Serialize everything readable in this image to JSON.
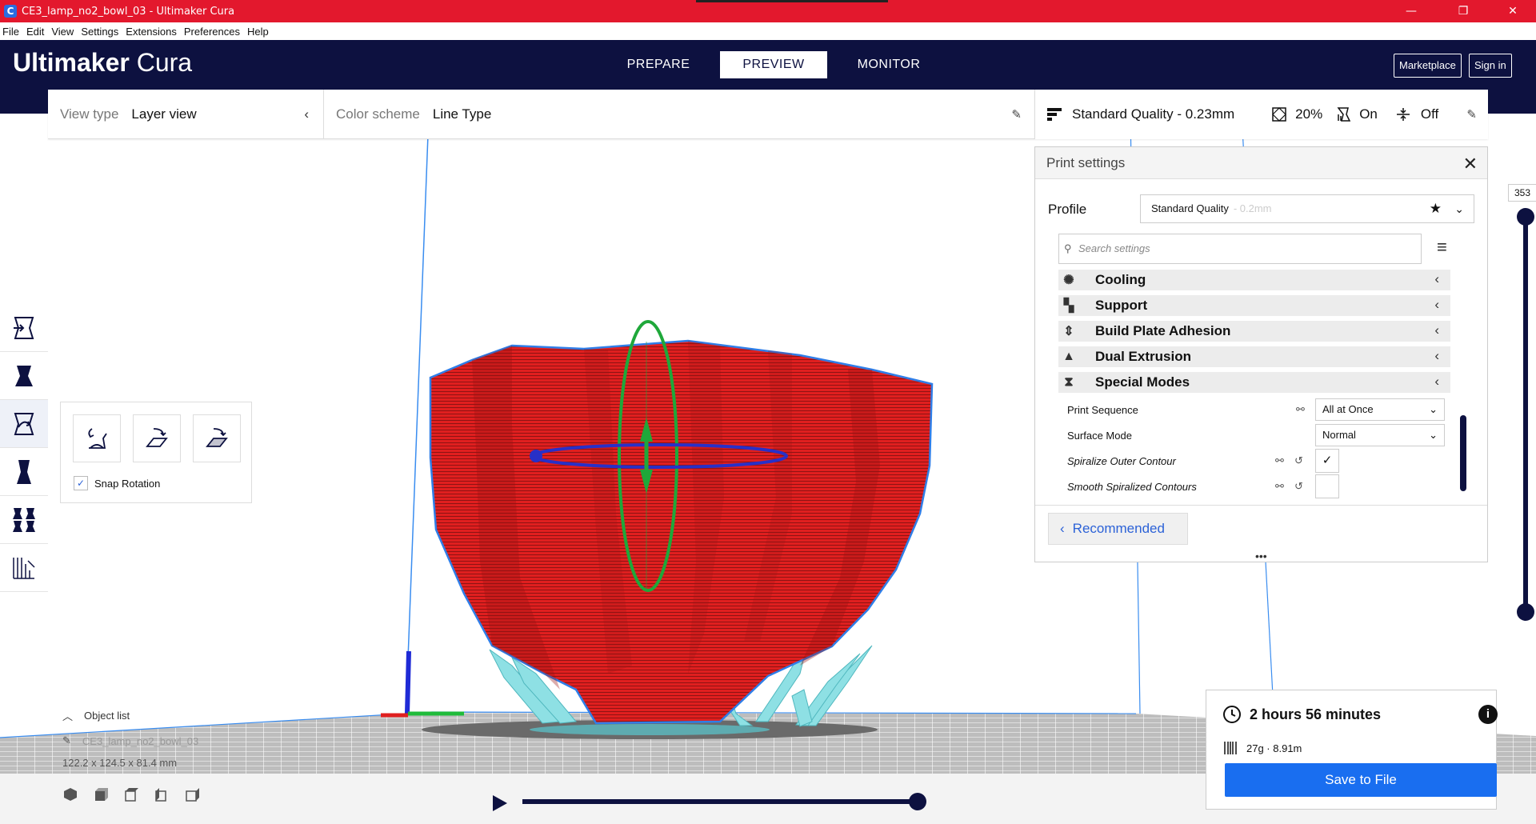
{
  "window": {
    "title": "CE3_lamp_no2_bowl_03 - Ultimaker Cura",
    "icon_letter": "C",
    "minimize": "—",
    "maximize": "❐",
    "close": "✕"
  },
  "menu": [
    "File",
    "Edit",
    "View",
    "Settings",
    "Extensions",
    "Preferences",
    "Help"
  ],
  "header": {
    "brand_bold": "Ultimaker",
    "brand_light": "Cura",
    "tabs": [
      {
        "label": "PREPARE",
        "active": false
      },
      {
        "label": "PREVIEW",
        "active": true
      },
      {
        "label": "MONITOR",
        "active": false
      }
    ],
    "marketplace": "Marketplace",
    "signin": "Sign in"
  },
  "viewbar": {
    "view_type_label": "View type",
    "view_type_value": "Layer view",
    "color_scheme_label": "Color scheme",
    "color_scheme_value": "Line Type"
  },
  "printbar": {
    "quality": "Standard Quality - 0.23mm",
    "infill": "20%",
    "support": "On",
    "adhesion": "Off"
  },
  "rotate_panel": {
    "snap_label": "Snap Rotation",
    "snap_checked": true
  },
  "settings": {
    "title": "Print settings",
    "profile_label": "Profile",
    "profile_value": "Standard Quality",
    "profile_dim": "- 0.2mm",
    "search_placeholder": "Search settings",
    "categories": [
      "Cooling",
      "Support",
      "Build Plate Adhesion",
      "Dual Extrusion",
      "Special Modes"
    ],
    "print_sequence_label": "Print Sequence",
    "print_sequence_value": "All at Once",
    "surface_mode_label": "Surface Mode",
    "surface_mode_value": "Normal",
    "spiralize_label": "Spiralize Outer Contour",
    "spiralize_checked": true,
    "smooth_label": "Smooth Spiralized Contours",
    "smooth_checked": false,
    "recommended": "Recommended"
  },
  "layer_slider": {
    "value": "353"
  },
  "object_list": {
    "toggle": "Object list",
    "object_name": "CE3_lamp_no2_bowl_03",
    "dimensions": "122.2 x 124.5 x 81.4 mm"
  },
  "estimate": {
    "time": "2 hours 56 minutes",
    "material": "27g · 8.91m",
    "save": "Save to File"
  },
  "colors": {
    "titlebar": "#e3182d",
    "header": "#0d1140",
    "accent": "#196ef0",
    "model_wall": "#e01f1f",
    "support": "#8ee0e4"
  }
}
